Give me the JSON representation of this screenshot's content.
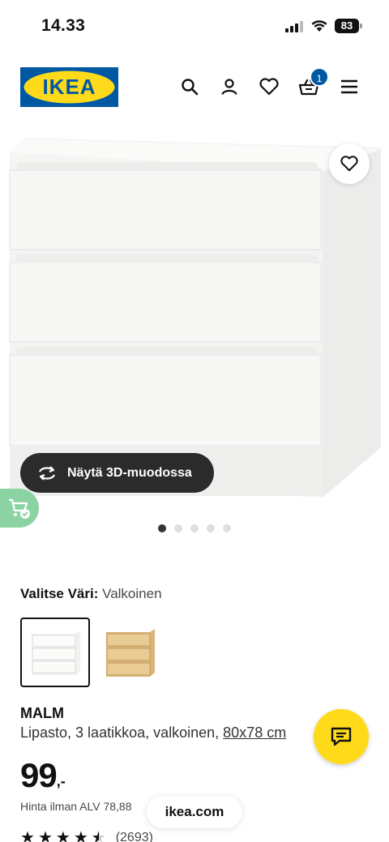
{
  "status_bar": {
    "time": "14.33",
    "battery": "83"
  },
  "header": {
    "logo_text": "IKEA",
    "cart_count": "1"
  },
  "gallery": {
    "view_3d_label": "Näytä 3D-muodossa",
    "image_count": 5,
    "active_index": 0
  },
  "color": {
    "label": "Valitse Väri:",
    "value": "Valkoinen",
    "options": [
      "white",
      "oak"
    ]
  },
  "product": {
    "name": "MALM",
    "description": "Lipasto, 3 laatikkoa, valkoinen, ",
    "size_link": "80x78 cm",
    "price_main": "99",
    "price_decimal": ",-",
    "vat_text": "Hinta ilman ALV 78,88",
    "rating": 4.5,
    "review_count": "(2693)"
  },
  "browser": {
    "url": "ikea.com"
  },
  "colors": {
    "brand_blue": "#0058a3",
    "brand_yellow": "#ffda1a",
    "dark_button": "#2b2b2b",
    "cart_green": "#8bd3a3"
  }
}
